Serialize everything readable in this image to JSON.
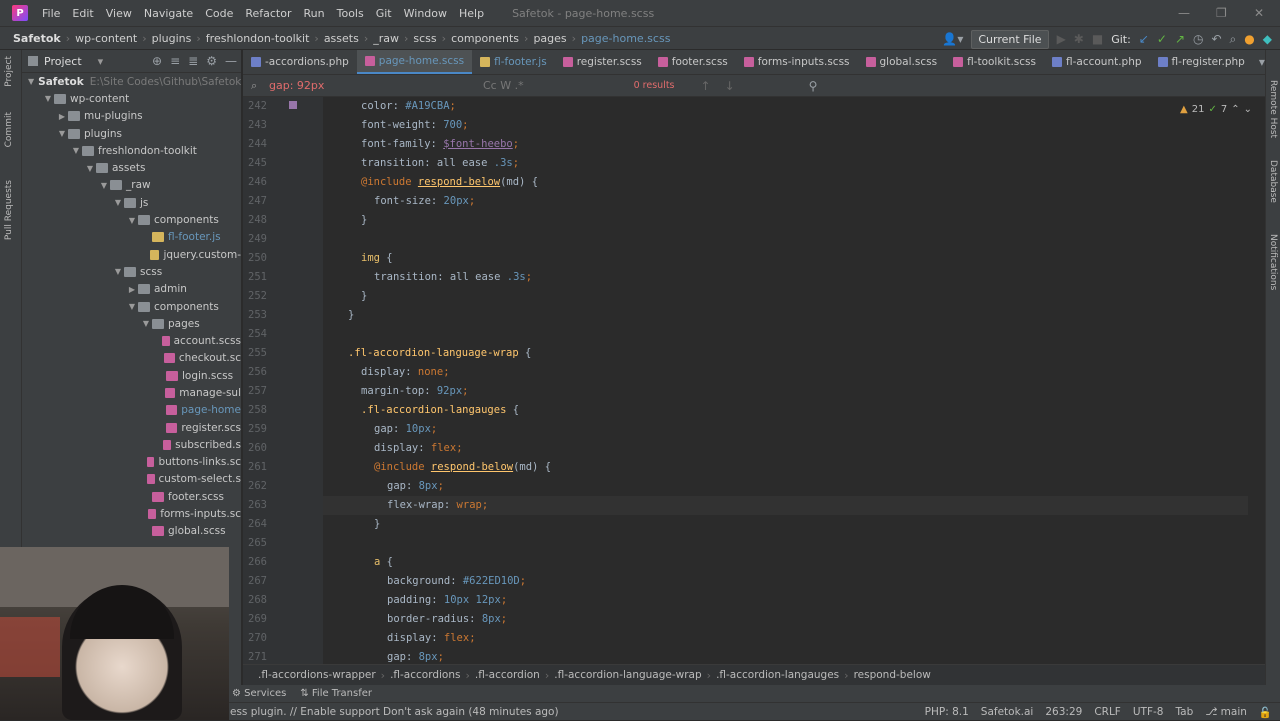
{
  "menubar": {
    "items": [
      "File",
      "Edit",
      "View",
      "Navigate",
      "Code",
      "Refactor",
      "Run",
      "Tools",
      "Git",
      "Window",
      "Help"
    ],
    "window_title": "Safetok - page-home.scss"
  },
  "navbar": {
    "crumbs": [
      "Safetok",
      "wp-content",
      "plugins",
      "freshlondon-toolkit",
      "assets",
      "_raw",
      "scss",
      "components",
      "pages",
      "page-home.scss"
    ],
    "run_config": "Current File",
    "git_label": "Git:"
  },
  "project": {
    "header": "Project",
    "root": {
      "name": "Safetok",
      "path": "E:\\Site Codes\\Github\\Safetok"
    },
    "tree": [
      {
        "d": 1,
        "t": "folder",
        "n": "wp-content",
        "open": true
      },
      {
        "d": 2,
        "t": "folder",
        "n": "mu-plugins",
        "open": false
      },
      {
        "d": 2,
        "t": "folder",
        "n": "plugins",
        "open": true
      },
      {
        "d": 3,
        "t": "folder",
        "n": "freshlondon-toolkit",
        "open": true
      },
      {
        "d": 4,
        "t": "folder",
        "n": "assets",
        "open": true
      },
      {
        "d": 5,
        "t": "folder",
        "n": "_raw",
        "open": true
      },
      {
        "d": 6,
        "t": "folder",
        "n": "js",
        "open": true
      },
      {
        "d": 7,
        "t": "folder",
        "n": "components",
        "open": true
      },
      {
        "d": 8,
        "t": "js",
        "n": "fl-footer.js",
        "mod": true
      },
      {
        "d": 8,
        "t": "js",
        "n": "jquery.custom-"
      },
      {
        "d": 6,
        "t": "folder",
        "n": "scss",
        "open": true
      },
      {
        "d": 7,
        "t": "folder",
        "n": "admin",
        "open": false
      },
      {
        "d": 7,
        "t": "folder",
        "n": "components",
        "open": true
      },
      {
        "d": 8,
        "t": "folder",
        "n": "pages",
        "open": true
      },
      {
        "d": 9,
        "t": "scss",
        "n": "account.scss"
      },
      {
        "d": 9,
        "t": "scss",
        "n": "checkout.sc"
      },
      {
        "d": 9,
        "t": "scss",
        "n": "login.scss"
      },
      {
        "d": 9,
        "t": "scss",
        "n": "manage-sul"
      },
      {
        "d": 9,
        "t": "scss",
        "n": "page-home",
        "mod": true
      },
      {
        "d": 9,
        "t": "scss",
        "n": "register.scs"
      },
      {
        "d": 9,
        "t": "scss",
        "n": "subscribed.s"
      },
      {
        "d": 8,
        "t": "scss",
        "n": "buttons-links.sc"
      },
      {
        "d": 8,
        "t": "scss",
        "n": "custom-select.s"
      },
      {
        "d": 8,
        "t": "scss",
        "n": "footer.scss"
      },
      {
        "d": 8,
        "t": "scss",
        "n": "forms-inputs.sc"
      },
      {
        "d": 8,
        "t": "scss",
        "n": "global.scss"
      }
    ]
  },
  "tabs": [
    {
      "label": "-accordions.php",
      "type": "php"
    },
    {
      "label": "page-home.scss",
      "type": "scss",
      "active": true,
      "mod": true
    },
    {
      "label": "fl-footer.js",
      "type": "js",
      "mod": true
    },
    {
      "label": "register.scss",
      "type": "scss"
    },
    {
      "label": "footer.scss",
      "type": "scss"
    },
    {
      "label": "forms-inputs.scss",
      "type": "scss"
    },
    {
      "label": "global.scss",
      "type": "scss"
    },
    {
      "label": "fl-toolkit.scss",
      "type": "scss"
    },
    {
      "label": "fl-account.php",
      "type": "php"
    },
    {
      "label": "fl-register.php",
      "type": "php"
    }
  ],
  "search": {
    "query": "gap: 92px",
    "results": "0 results"
  },
  "inspections": {
    "warnings": "21",
    "ok": "7"
  },
  "code": {
    "current_line": 263,
    "lines": [
      {
        "n": 242,
        "t": [
          [
            "color: ",
            "s"
          ],
          [
            "#A19CBA",
            "n"
          ],
          [
            ";",
            "k"
          ]
        ],
        "i": 4
      },
      {
        "n": 243,
        "t": [
          [
            "font-weight: ",
            "s"
          ],
          [
            "700",
            "n"
          ],
          [
            ";",
            "k"
          ]
        ],
        "i": 4
      },
      {
        "n": 244,
        "t": [
          [
            "font-family: ",
            "s"
          ],
          [
            "$font-heebo",
            "v"
          ],
          [
            ";",
            "k"
          ]
        ],
        "i": 4
      },
      {
        "n": 245,
        "t": [
          [
            "transition: ",
            "s"
          ],
          [
            "all ease ",
            "s"
          ],
          [
            ".3s",
            "n"
          ],
          [
            ";",
            "k"
          ]
        ],
        "i": 4
      },
      {
        "n": 246,
        "t": [
          [
            "@include ",
            "k"
          ],
          [
            "respond-below",
            "c"
          ],
          [
            "(md) {",
            "s"
          ]
        ],
        "i": 4
      },
      {
        "n": 247,
        "t": [
          [
            "font-size: ",
            "s"
          ],
          [
            "20px",
            "n"
          ],
          [
            ";",
            "k"
          ]
        ],
        "i": 6
      },
      {
        "n": 248,
        "t": [
          [
            "}",
            "s"
          ]
        ],
        "i": 4
      },
      {
        "n": 249,
        "t": [],
        "i": 0
      },
      {
        "n": 250,
        "t": [
          [
            "img",
            "p"
          ],
          [
            " {",
            "s"
          ]
        ],
        "i": 4
      },
      {
        "n": 251,
        "t": [
          [
            "transition: ",
            "s"
          ],
          [
            "all ease ",
            "s"
          ],
          [
            ".3s",
            "n"
          ],
          [
            ";",
            "k"
          ]
        ],
        "i": 6
      },
      {
        "n": 252,
        "t": [
          [
            "}",
            "s"
          ]
        ],
        "i": 4
      },
      {
        "n": 253,
        "t": [
          [
            "}",
            "s"
          ]
        ],
        "i": 2
      },
      {
        "n": 254,
        "t": [],
        "i": 0
      },
      {
        "n": 255,
        "t": [
          [
            ".fl-accordion-language-wrap",
            "sel"
          ],
          [
            " {",
            "s"
          ]
        ],
        "i": 2
      },
      {
        "n": 256,
        "t": [
          [
            "display: ",
            "s"
          ],
          [
            "none",
            "k"
          ],
          [
            ";",
            "k"
          ]
        ],
        "i": 4
      },
      {
        "n": 257,
        "t": [
          [
            "margin-top: ",
            "s"
          ],
          [
            "92px",
            "n"
          ],
          [
            ";",
            "k"
          ]
        ],
        "i": 4
      },
      {
        "n": 258,
        "t": [
          [
            ".fl-accordion-langauges",
            "sel"
          ],
          [
            " {",
            "s"
          ]
        ],
        "i": 4
      },
      {
        "n": 259,
        "t": [
          [
            "gap: ",
            "s"
          ],
          [
            "10px",
            "n"
          ],
          [
            ";",
            "k"
          ]
        ],
        "i": 6
      },
      {
        "n": 260,
        "t": [
          [
            "display: ",
            "s"
          ],
          [
            "flex",
            "k"
          ],
          [
            ";",
            "k"
          ]
        ],
        "i": 6
      },
      {
        "n": 261,
        "t": [
          [
            "@include ",
            "k"
          ],
          [
            "respond-below",
            "c"
          ],
          [
            "(md) {",
            "s"
          ]
        ],
        "i": 6
      },
      {
        "n": 262,
        "t": [
          [
            "gap: ",
            "s"
          ],
          [
            "8px",
            "n"
          ],
          [
            ";",
            "k"
          ]
        ],
        "i": 8
      },
      {
        "n": 263,
        "t": [
          [
            "flex-wrap: ",
            "s"
          ],
          [
            "wrap",
            "k"
          ],
          [
            ";",
            "k"
          ]
        ],
        "i": 8
      },
      {
        "n": 264,
        "t": [
          [
            "}",
            "s"
          ]
        ],
        "i": 6
      },
      {
        "n": 265,
        "t": [],
        "i": 0
      },
      {
        "n": 266,
        "t": [
          [
            "a",
            "p"
          ],
          [
            " {",
            "s"
          ]
        ],
        "i": 6
      },
      {
        "n": 267,
        "t": [
          [
            "background: ",
            "s"
          ],
          [
            "#622ED10D",
            "n"
          ],
          [
            ";",
            "k"
          ]
        ],
        "i": 8
      },
      {
        "n": 268,
        "t": [
          [
            "padding: ",
            "s"
          ],
          [
            "10px 12px",
            "n"
          ],
          [
            ";",
            "k"
          ]
        ],
        "i": 8
      },
      {
        "n": 269,
        "t": [
          [
            "border-radius: ",
            "s"
          ],
          [
            "8px",
            "n"
          ],
          [
            ";",
            "k"
          ]
        ],
        "i": 8
      },
      {
        "n": 270,
        "t": [
          [
            "display: ",
            "s"
          ],
          [
            "flex",
            "k"
          ],
          [
            ";",
            "k"
          ]
        ],
        "i": 8
      },
      {
        "n": 271,
        "t": [
          [
            "gap: ",
            "s"
          ],
          [
            "8px",
            "n"
          ],
          [
            ";",
            "k"
          ]
        ],
        "i": 8
      }
    ]
  },
  "breadcrumb": [
    ".fl-accordions-wrapper",
    ".fl-accordions",
    ".fl-accordion",
    ".fl-accordion-language-wrap",
    ".fl-accordion-langauges",
    "respond-below"
  ],
  "toolwin": {
    "items": [
      "Services",
      "File Transfer"
    ]
  },
  "status": {
    "message": "ess plugin. // Enable support  Don't ask again (48 minutes ago)",
    "php": "PHP: 8.1",
    "project": "Safetok.ai",
    "pos": "263:29",
    "eol": "CRLF",
    "enc": "UTF-8",
    "indent": "Tab",
    "branch": "main"
  },
  "colors": {
    "accent": "#4a88c7",
    "bg": "#2b2b2b",
    "panel": "#3c3f41"
  }
}
